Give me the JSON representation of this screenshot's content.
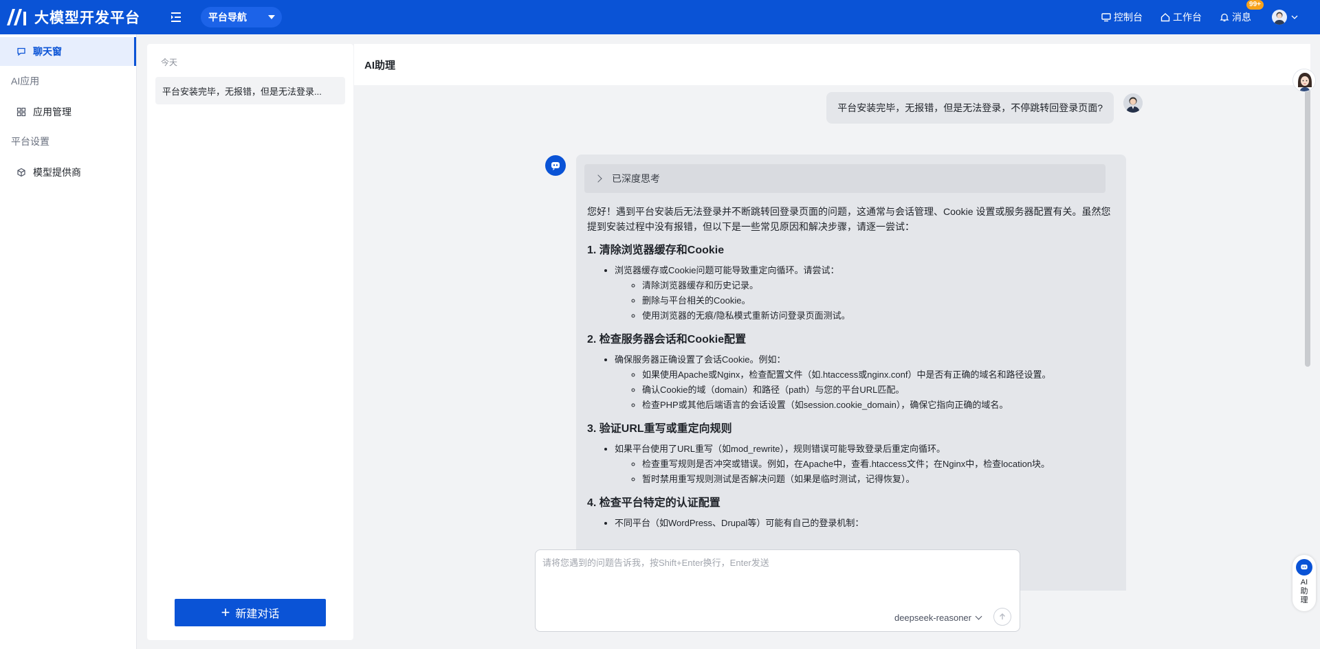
{
  "header": {
    "app_title": "大模型开发平台",
    "platform_nav": "平台导航",
    "console": "控制台",
    "workbench": "工作台",
    "messages": "消息",
    "messages_badge": "99+"
  },
  "sidebar": {
    "items": [
      {
        "label": "聊天窗",
        "icon": "chat-icon",
        "active": true
      },
      {
        "group": "AI应用"
      },
      {
        "label": "应用管理",
        "icon": "grid-icon"
      },
      {
        "group": "平台设置"
      },
      {
        "label": "模型提供商",
        "icon": "cube-icon"
      }
    ]
  },
  "conversations": {
    "day_label": "今天",
    "items": [
      "平台安装完毕，无报错，但是无法登录..."
    ],
    "new_chat": "新建对话"
  },
  "chat": {
    "title": "AI助理",
    "user_message": "平台安装完毕，无报错，但是无法登录，不停跳转回登录页面?",
    "thinking_label": "已深度思考",
    "intro": "您好！遇到平台安装后无法登录并不断跳转回登录页面的问题，这通常与会话管理、Cookie 设置或服务器配置有关。虽然您提到安装过程中没有报错，但以下是一些常见原因和解决步骤，请逐一尝试：",
    "sections": [
      {
        "heading": "1. 清除浏览器缓存和Cookie",
        "bullet": "浏览器缓存或Cookie问题可能导致重定向循环。请尝试：",
        "sub": [
          "清除浏览器缓存和历史记录。",
          "删除与平台相关的Cookie。",
          "使用浏览器的无痕/隐私模式重新访问登录页面测试。"
        ]
      },
      {
        "heading": "2. 检查服务器会话和Cookie配置",
        "bullet": "确保服务器正确设置了会话Cookie。例如：",
        "sub": [
          "如果使用Apache或Nginx，检查配置文件（如.htaccess或nginx.conf）中是否有正确的域名和路径设置。",
          "确认Cookie的域（domain）和路径（path）与您的平台URL匹配。",
          "检查PHP或其他后端语言的会话设置（如session.cookie_domain），确保它指向正确的域名。"
        ]
      },
      {
        "heading": "3. 验证URL重写或重定向规则",
        "bullet": "如果平台使用了URL重写（如mod_rewrite），规则错误可能导致登录后重定向循环。",
        "sub": [
          "检查重写规则是否冲突或错误。例如，在Apache中，查看.htaccess文件；在Nginx中，检查location块。",
          "暂时禁用重写规则测试是否解决问题（如果是临时测试，记得恢复）。"
        ]
      },
      {
        "heading": "4. 检查平台特定的认证配置",
        "bullet": "不同平台（如WordPress、Drupal等）可能有自己的登录机制：",
        "sub": []
      }
    ],
    "input_placeholder": "请将您遇到的问题告诉我，按Shift+Enter换行，Enter发送",
    "input_value": "",
    "model": "deepseek-reasoner"
  },
  "float": {
    "ai_label": "AI助理"
  },
  "colors": {
    "brand": "#0a53d6",
    "badge": "#f7a21b"
  }
}
